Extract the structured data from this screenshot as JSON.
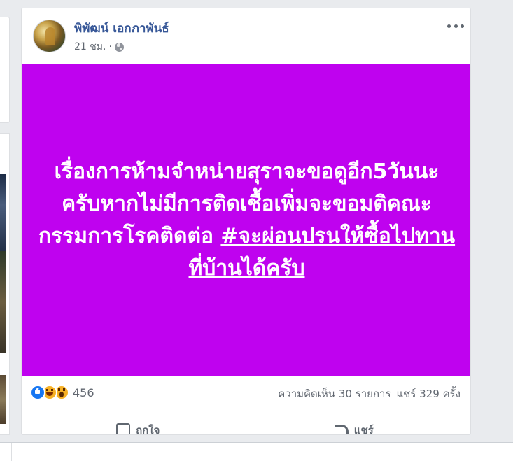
{
  "post": {
    "author": "พิพัฒน์ เอกภาพันธ์",
    "time": "21 ชม.",
    "meta_separator": "·",
    "background_color": "#bf02ef",
    "text_main": "เรื่องการห้ามจำหน่ายสุราจะขอดูอีก5วันนะครับหากไม่มีการติดเชื้อเพิ่มจะขอมติคณะกรรมการโรคติดต่อ ",
    "hashtag": "#จะผ่อนปรนให้ซื้อไปทานที่บ้านได้ครับ",
    "reaction_icons": [
      "like-icon",
      "haha-icon",
      "wow-icon"
    ],
    "reaction_count": "456",
    "comments": "ความคิดเห็น 30 รายการ",
    "shares": "แชร์ 329 ครั้ง",
    "actions": {
      "like": "ถูกใจ",
      "share": "แชร์"
    }
  },
  "colors": {
    "author_link": "#385898",
    "page_bg": "#e9ebee"
  }
}
